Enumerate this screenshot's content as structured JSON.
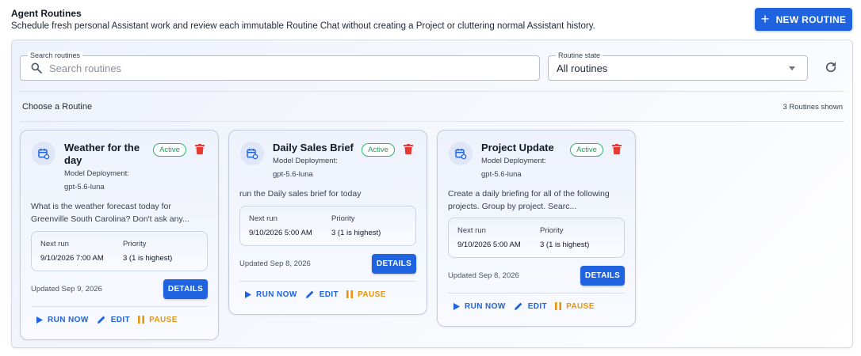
{
  "header": {
    "title": "Agent Routines",
    "subtitle": "Schedule fresh personal Assistant work and review each immutable Routine Chat without creating a Project or cluttering normal Assistant history.",
    "new_routine_label": "NEW ROUTINE"
  },
  "filters": {
    "search_label": "Search routines",
    "search_placeholder": "Search routines",
    "state_label": "Routine state",
    "state_value": "All routines"
  },
  "list": {
    "title": "Choose a Routine",
    "count": "3 Routines shown"
  },
  "colors": {
    "accent": "#1f63e0",
    "active": "#1f9d5a",
    "delete": "#e53935",
    "pause": "#e8950c"
  },
  "card_labels": {
    "model_label": "Model Deployment:",
    "next_run_label": "Next run",
    "priority_label": "Priority",
    "details": "DETAILS",
    "run_now": "RUN NOW",
    "edit": "EDIT",
    "pause": "PAUSE"
  },
  "routines": [
    {
      "name": "Weather for the day",
      "status": "Active",
      "model": "gpt-5.6-luna",
      "description": "What is the weather forecast today for Greenville South Carolina? Don't ask any...",
      "next_run": "9/10/2026 7:00 AM",
      "priority": "3 (1 is highest)",
      "updated": "Updated Sep 9, 2026"
    },
    {
      "name": "Daily Sales Brief",
      "status": "Active",
      "model": "gpt-5.6-luna",
      "description": "run the Daily sales brief for today",
      "next_run": "9/10/2026 5:00 AM",
      "priority": "3 (1 is highest)",
      "updated": "Updated Sep 8, 2026"
    },
    {
      "name": "Project Update",
      "status": "Active",
      "model": "gpt-5.6-luna",
      "description": "Create a daily briefing for all of the following projects. Group by project. Searc...",
      "next_run": "9/10/2026 5:00 AM",
      "priority": "3 (1 is highest)",
      "updated": "Updated Sep 8, 2026"
    }
  ]
}
